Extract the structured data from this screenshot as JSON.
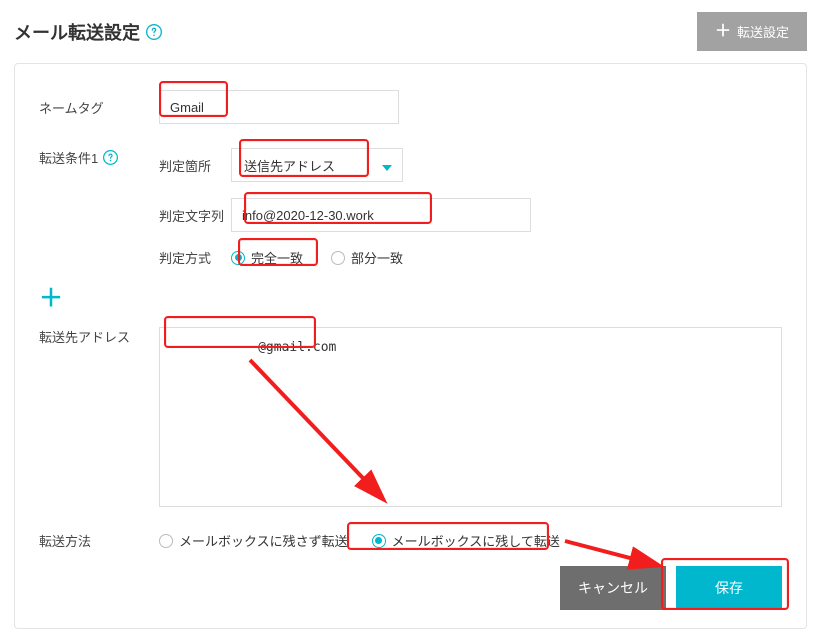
{
  "header": {
    "title": "メール転送設定",
    "add_button": "転送設定"
  },
  "form": {
    "nametag": {
      "label": "ネームタグ",
      "value": "Gmail"
    },
    "condition_label": "転送条件1",
    "judge_place": {
      "label": "判定箇所",
      "selected": "送信先アドレス"
    },
    "judge_string": {
      "label": "判定文字列",
      "value": "info@2020-12-30.work"
    },
    "judge_method": {
      "label": "判定方式",
      "exact": "完全一致",
      "partial": "部分一致"
    },
    "dest": {
      "label": "転送先アドレス",
      "value": "           @gmail.com"
    },
    "method": {
      "label": "転送方法",
      "delete": "メールボックスに残さず転送",
      "keep": "メールボックスに残して転送"
    },
    "buttons": {
      "cancel": "キャンセル",
      "save": "保存"
    }
  }
}
